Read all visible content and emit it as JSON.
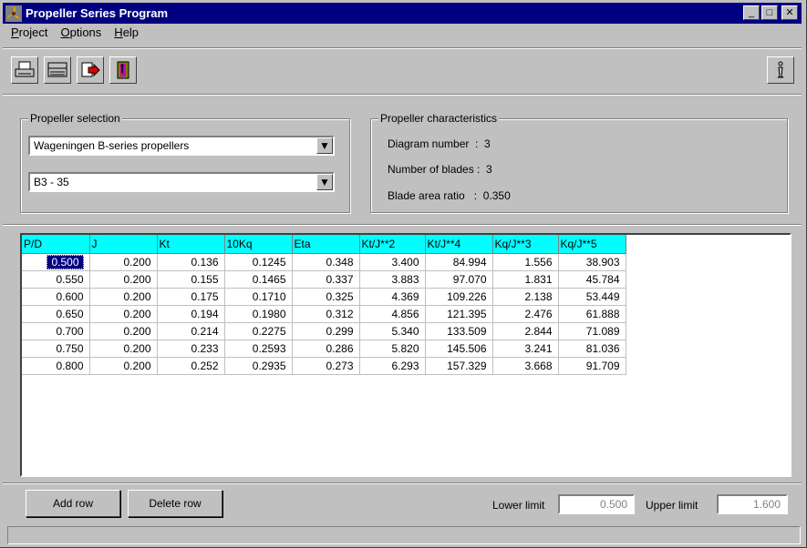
{
  "window": {
    "title": "Propeller Series Program"
  },
  "menu": {
    "project": "roject",
    "options": "ptions",
    "help": "elp",
    "project_u": "P",
    "options_u": "O",
    "help_u": "H"
  },
  "toolbar": {
    "icons": [
      "printer-icon",
      "printer-setup-icon",
      "export-icon",
      "exit-door-icon"
    ],
    "info_icon": "info-icon"
  },
  "selection": {
    "legend": "Propeller selection",
    "series_value": "Wageningen B-series propellers",
    "type_value": "B3 - 35"
  },
  "characteristics": {
    "legend": "Propeller characteristics",
    "diagram_label": "Diagram number  :  3",
    "blades_label": "Number of blades :  3",
    "area_label": "Blade area ratio   :  0.350"
  },
  "table": {
    "headers": [
      "P/D",
      "J",
      "Kt",
      "10Kq",
      "Eta",
      "Kt/J**2",
      "Kt/J**4",
      "Kq/J**3",
      "Kq/J**5"
    ],
    "rows": [
      [
        "0.500",
        "0.200",
        "0.136",
        "0.1245",
        "0.348",
        "3.400",
        "84.994",
        "1.556",
        "38.903"
      ],
      [
        "0.550",
        "0.200",
        "0.155",
        "0.1465",
        "0.337",
        "3.883",
        "97.070",
        "1.831",
        "45.784"
      ],
      [
        "0.600",
        "0.200",
        "0.175",
        "0.1710",
        "0.325",
        "4.369",
        "109.226",
        "2.138",
        "53.449"
      ],
      [
        "0.650",
        "0.200",
        "0.194",
        "0.1980",
        "0.312",
        "4.856",
        "121.395",
        "2.476",
        "61.888"
      ],
      [
        "0.700",
        "0.200",
        "0.214",
        "0.2275",
        "0.299",
        "5.340",
        "133.509",
        "2.844",
        "71.089"
      ],
      [
        "0.750",
        "0.200",
        "0.233",
        "0.2593",
        "0.286",
        "5.820",
        "145.506",
        "3.241",
        "81.036"
      ],
      [
        "0.800",
        "0.200",
        "0.252",
        "0.2935",
        "0.273",
        "6.293",
        "157.329",
        "3.668",
        "91.709"
      ]
    ]
  },
  "buttons": {
    "add_row": "Add row",
    "delete_row": "Delete row"
  },
  "limits": {
    "lower_label": "Lower limit",
    "lower_value": "0.500",
    "upper_label": "Upper limit",
    "upper_value": "1.600"
  },
  "colors": {
    "title_bar": "#000080",
    "header_bg": "#00ffff",
    "face": "#c0c0c0"
  }
}
